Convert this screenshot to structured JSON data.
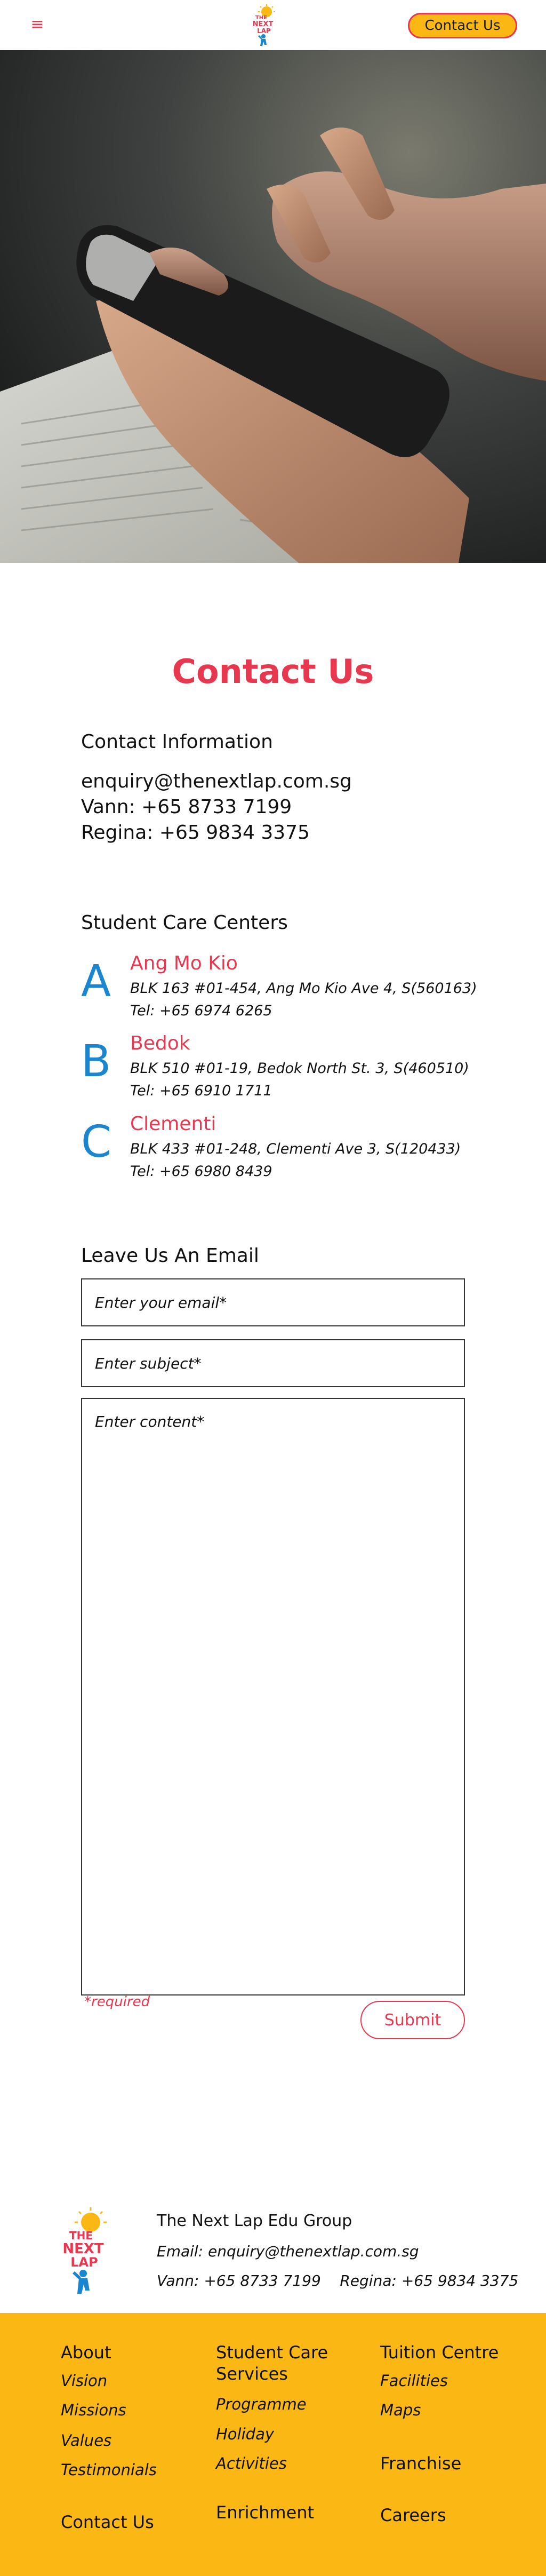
{
  "header": {
    "menu_icon": "hamburger-icon",
    "logo_text": [
      "THE",
      "NEXT",
      "LAP"
    ],
    "contact_button": "Contact Us"
  },
  "hero": {
    "image": "hands holding smartphone over newspaper"
  },
  "page_title": "Contact Us",
  "contact_info": {
    "heading": "Contact Information",
    "email": "enquiry@thenextlap.com.sg",
    "vann": "Vann: +65 8733 7199",
    "regina": "Regina: +65 9834 3375"
  },
  "centers": {
    "heading": "Student Care Centers",
    "items": [
      {
        "letter": "A",
        "name": "Ang Mo Kio",
        "address": "BLK 163 #01-454, Ang Mo Kio Ave 4, S(560163)",
        "tel": "Tel: +65 6974 6265"
      },
      {
        "letter": "B",
        "name": "Bedok",
        "address": "BLK 510 #01-19, Bedok North St. 3, S(460510)",
        "tel": "Tel: +65 6910 1711"
      },
      {
        "letter": "C",
        "name": "Clementi",
        "address": "BLK 433 #01-248, Clementi Ave 3, S(120433)",
        "tel": "Tel: +65 6980 8439"
      }
    ]
  },
  "form": {
    "heading": "Leave Us An Email",
    "email_placeholder": "Enter your email*",
    "subject_placeholder": "Enter subject*",
    "content_placeholder": "Enter content*",
    "required_note": "*required",
    "submit_label": "Submit"
  },
  "footer": {
    "org_name": "The Next Lap Edu Group",
    "email": "Email: enquiry@thenextlap.com.sg",
    "phones": "Vann: +65 8733 7199    Regina: +65 9834 3375",
    "nav": {
      "about": "About",
      "vision": "Vision",
      "missions": "Missions",
      "values": "Values",
      "testimonials": "Testimonials",
      "contact_us": "Contact Us",
      "student_care_1": "Student Care",
      "student_care_2": "Services",
      "programme": "Programme",
      "holiday": "Holiday",
      "activities": "Activities",
      "enrichment": "Enrichment",
      "tuition_centre": "Tuition Centre",
      "facilities": "Facilities",
      "maps": "Maps",
      "franchise": "Franchise",
      "careers": "Careers"
    }
  },
  "colors": {
    "accent_red": "#e8384f",
    "brand_yellow": "#fbb815",
    "letter_blue": "#1a86d0"
  }
}
